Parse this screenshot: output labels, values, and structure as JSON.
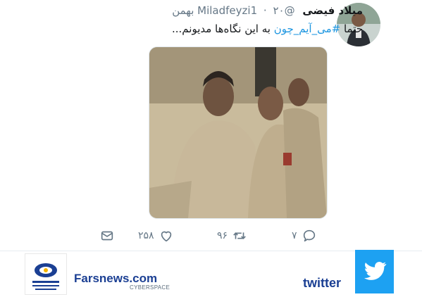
{
  "tweet": {
    "author_name": "میلاد فیضی",
    "author_handle": "@Miladfeyzi1",
    "separator_dot": "·",
    "date": "۲۰ بهمن",
    "text_prefix": "حتما ",
    "hashtag": "#می_آیم_چون",
    "text_suffix": " به این نگاه‌ها مدیونم...",
    "actions": {
      "reply_icon": "reply-icon",
      "reply_count": "۷",
      "retweet_icon": "retweet-icon",
      "retweet_count": "۹۶",
      "like_icon": "heart-icon",
      "like_count": "۲۵۸",
      "message_icon": "direct-message-icon"
    }
  },
  "footer": {
    "brand_name": "Farsnews.com",
    "brand_subtitle": "CYBERSPACE",
    "platform_label": "twitter",
    "platform_icon": "twitter-bird-icon"
  },
  "colors": {
    "accent": "#1b95e0",
    "muted": "#657786",
    "brand_blue": "#1b3f93",
    "twitter_blue": "#1da1f2"
  }
}
